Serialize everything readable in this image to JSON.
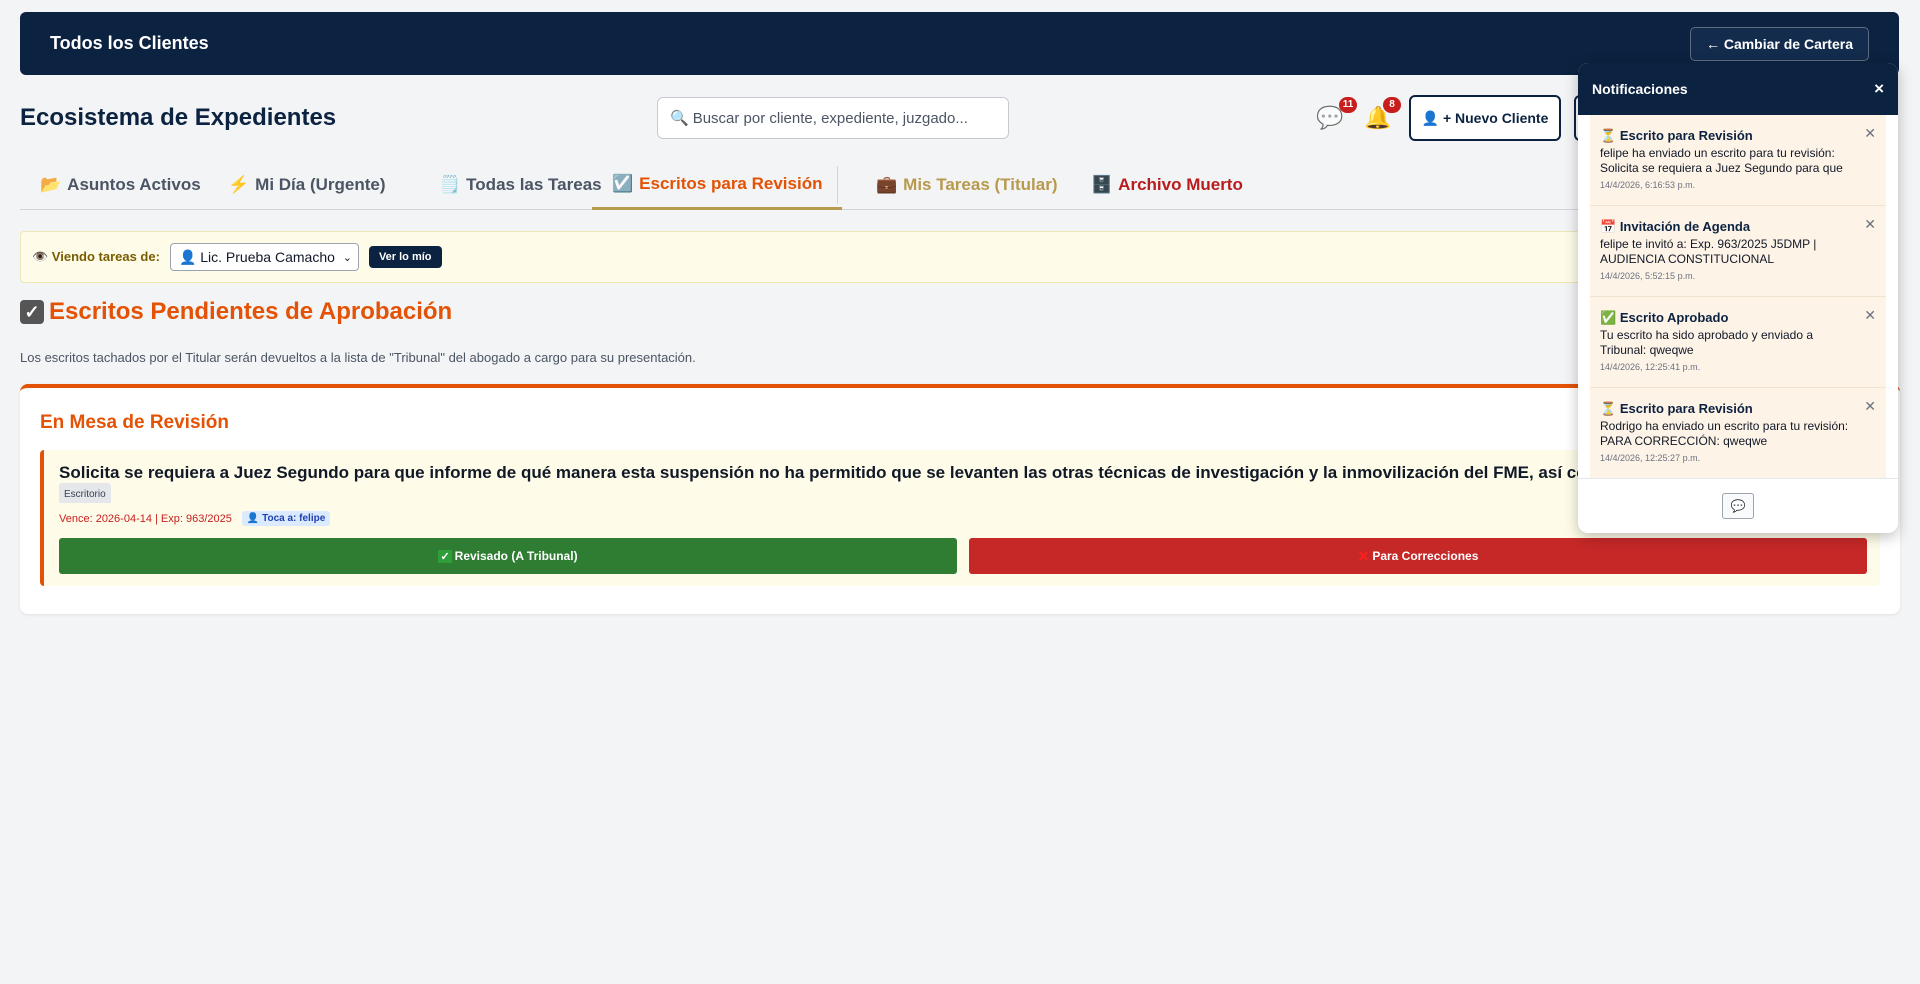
{
  "header": {
    "title": "Todos los Clientes",
    "cartera_button": "← Cambiar de Cartera"
  },
  "page": {
    "title": "Ecosistema de Expedientes"
  },
  "search": {
    "icon": "🔍",
    "placeholder": "Buscar por cliente, expediente, juzgado..."
  },
  "toolbar": {
    "messages_icon": "💬",
    "messages_count": "11",
    "bell_icon": "🔔",
    "bell_count": "8",
    "new_client_label": "👤 + Nuevo Cliente"
  },
  "tabs": [
    {
      "icon": "📂",
      "label": "Asuntos Activos"
    },
    {
      "icon": "⚡",
      "label": "Mi Día (Urgente)"
    },
    {
      "icon": "🗒️",
      "label": "Todas las Tareas"
    },
    {
      "icon": "☑️",
      "label": "Escritos para Revisión"
    },
    {
      "icon": "💼",
      "label": "Mis Tareas (Titular)"
    },
    {
      "icon": "🗄️",
      "label": "Archivo Muerto"
    }
  ],
  "viewer": {
    "label": "👁️ Viendo tareas de:",
    "selected": "👤 Lic. Prueba Camacho",
    "ver_button": "Ver lo mío"
  },
  "section": {
    "icon": "✓",
    "title": "Escritos Pendientes de Aprobación",
    "description": "Los escritos tachados por el Titular serán devueltos a la lista de \"Tribunal\" del abogado a cargo para su presentación."
  },
  "review": {
    "title": "En Mesa de Revisión",
    "item": {
      "text": "Solicita se requiera a Juez Segundo para que informe de qué manera esta suspensión no ha permitido que se levanten las otras técnicas de investigación y la inmovilización del FME, así como que exprese a qué se alude",
      "tag": "Escritorio",
      "meta": "Vence: 2026-04-14 | Exp: 963/2025",
      "assignee": "👤 Toca a: felipe",
      "approve": "Revisado (A Tribunal)",
      "approve_icon": "✓",
      "reject": "Para Correcciones",
      "reject_icon": "✕"
    }
  },
  "notifications": {
    "title": "Notificaciones",
    "close": "×",
    "items": [
      {
        "icon": "⏳",
        "title": "Escrito para Revisión",
        "body": "felipe ha enviado un escrito para tu revisión: Solicita se requiera a Juez Segundo para que informe de qué manera",
        "date": "14/4/2026, 6:16:53 p.m."
      },
      {
        "icon": "📅",
        "title": "Invitación de Agenda",
        "body": "felipe te invitó a: Exp. 963/2025 J5DMP | AUDIENCIA CONSTITUCIONAL",
        "date": "14/4/2026, 5:52:15 p.m."
      },
      {
        "icon": "✅",
        "title": "Escrito Aprobado",
        "body": "Tu escrito ha sido aprobado y enviado a Tribunal: qweqwe",
        "date": "14/4/2026, 12:25:41 p.m."
      },
      {
        "icon": "⏳",
        "title": "Escrito para Revisión",
        "body": "Rodrigo ha enviado un escrito para tu revisión: PARA CORRECCIÓN: qweqwe",
        "date": "14/4/2026, 12:25:27 p.m."
      }
    ],
    "footer_icon": "💬"
  },
  "colors": {
    "navy": "#0b2240",
    "accent": "#e35205",
    "approve": "#2e7d32",
    "reject": "#c62828",
    "gold": "#b89a4e"
  }
}
